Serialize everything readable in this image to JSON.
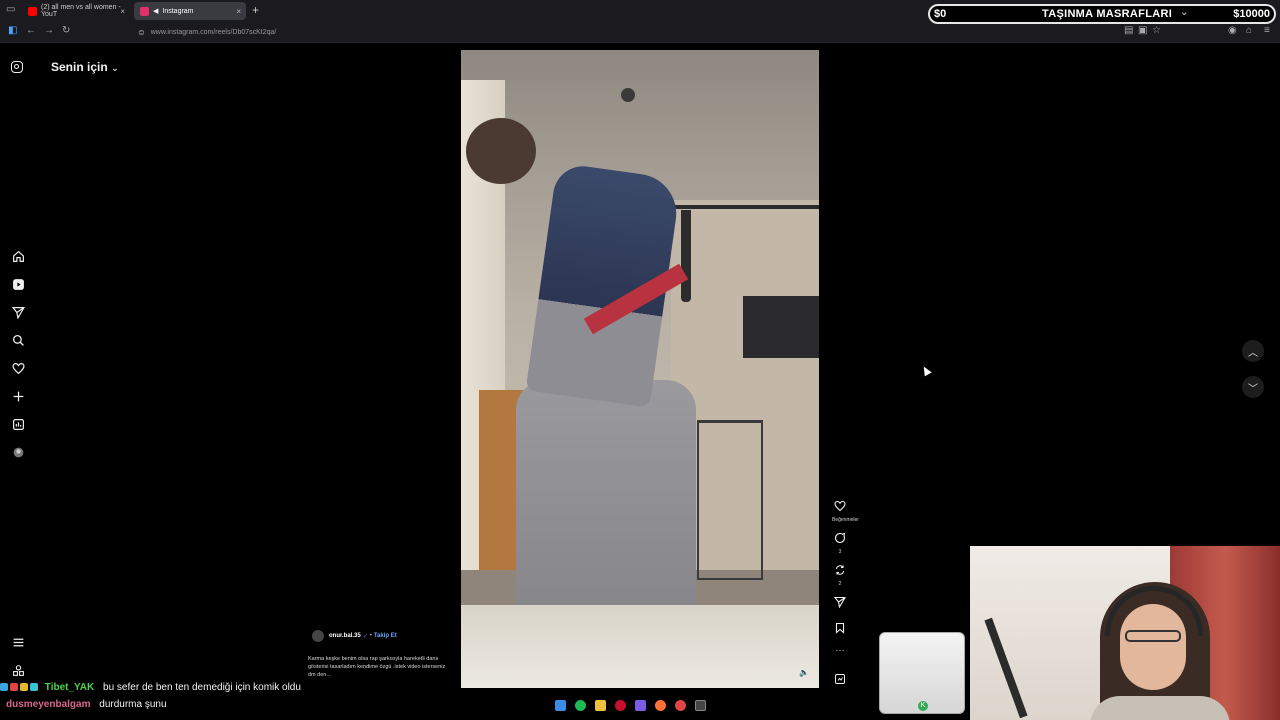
{
  "browser": {
    "tabs": [
      {
        "title": "(2) all men vs all women - YouT",
        "favicon_color": "#ff0000"
      },
      {
        "title": "Instagram",
        "favicon_color": "#e1306c"
      }
    ],
    "url": "www.instagram.com/reels/Db07scKt2qa/"
  },
  "overlay": {
    "donation_left": "$0",
    "donation_title": "TAŞINMA MASRAFLARI",
    "donation_right": "$10000"
  },
  "instagram": {
    "feed_selector": "Senin için",
    "sidebar": [
      {
        "name": "home-icon"
      },
      {
        "name": "reels-icon"
      },
      {
        "name": "send-icon"
      },
      {
        "name": "search-icon"
      },
      {
        "name": "heart-icon"
      },
      {
        "name": "create-icon"
      },
      {
        "name": "dashboard-icon"
      },
      {
        "name": "profile-icon"
      }
    ],
    "reel": {
      "author": "onur.bal.35",
      "verified_mark": "✓",
      "separator": "•",
      "follow": "Takip Et",
      "caption": "Karma keşke benim olsa rap şarkısıyla hareketli dans gösterisi tasarladım kendime özgü .istek video isterseniz dm den...",
      "actions": {
        "like_label": "Beğenmeler",
        "comments_count": "3",
        "reposts_count": "2"
      }
    }
  },
  "chat": [
    {
      "user": "Tibet_YAK",
      "user_color": "#4fd14f",
      "message": "bu sefer de ben ten demediği için komik oldu"
    },
    {
      "user": "dusmeyenbalgam",
      "user_color": "#d9668a",
      "message": "durdurma şunu"
    }
  ]
}
